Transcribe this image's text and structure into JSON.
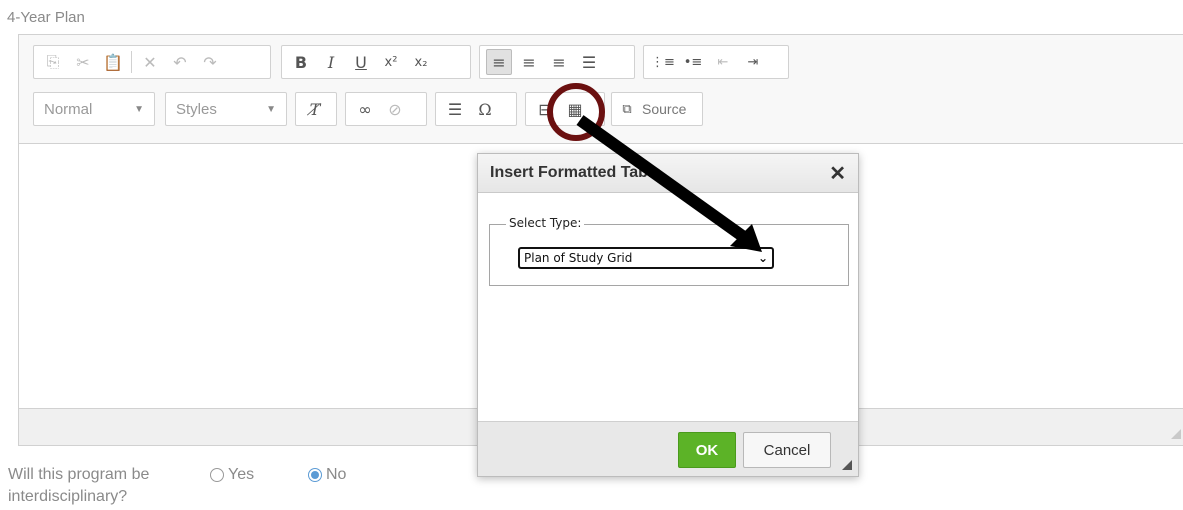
{
  "field_label": "4-Year Plan",
  "toolbar": {
    "format_combo": "Normal",
    "styles_combo": "Styles",
    "source_label": "Source"
  },
  "dialog": {
    "title": "Insert Formatted Table",
    "close_glyph": "✕",
    "fieldset_legend": "Select Type:",
    "select_value": "Plan of Study Grid",
    "ok_label": "OK",
    "cancel_label": "Cancel"
  },
  "question": {
    "text": "Will this program be interdisciplinary?",
    "options": [
      {
        "label": "Yes",
        "checked": false
      },
      {
        "label": "No",
        "checked": true
      }
    ]
  },
  "annotation": {
    "highlight_color": "#6b1010",
    "arrow_color": "#000000"
  }
}
